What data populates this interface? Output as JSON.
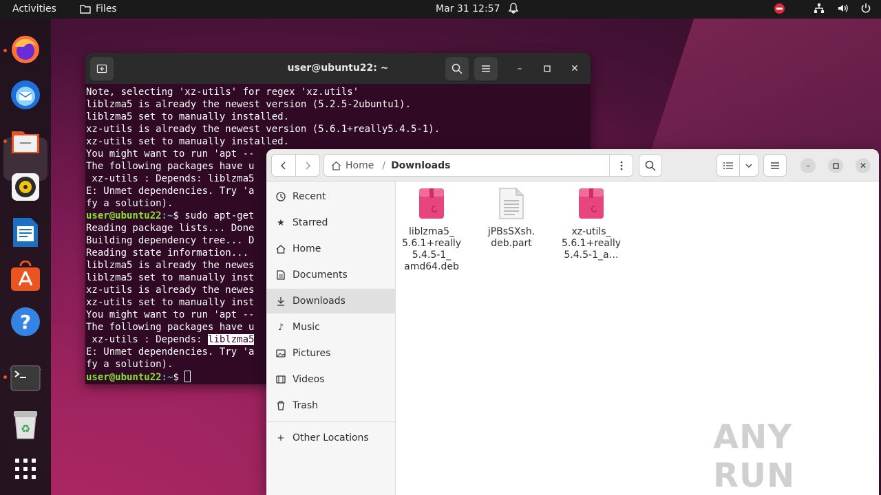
{
  "topbar": {
    "activities": "Activities",
    "app_name": "Files",
    "clock": "Mar 31  12:57"
  },
  "dock": {
    "apps": [
      "Firefox",
      "Thunderbird",
      "Files",
      "Rhythmbox",
      "LibreOffice Writer",
      "Ubuntu Software",
      "Help",
      "Terminal",
      "Trash",
      "Show Applications"
    ]
  },
  "terminal": {
    "title": "user@ubuntu22: ~",
    "lines": [
      "Note, selecting 'xz-utils' for regex 'xz.utils'",
      "liblzma5 is already the newest version (5.2.5-2ubuntu1).",
      "liblzma5 set to manually installed.",
      "xz-utils is already the newest version (5.6.1+really5.4.5-1).",
      "xz-utils set to manually installed.",
      "You might want to run 'apt --",
      "The following packages have u",
      " xz-utils : Depends: liblzma5",
      "E: Unmet dependencies. Try 'a",
      "fy a solution)."
    ],
    "prompt_user": "user@ubuntu22",
    "prompt_path": ":~",
    "prompt_symbol": "$",
    "command1": " sudo apt-get",
    "lines2": [
      "Reading package lists... Done",
      "Building dependency tree... D",
      "Reading state information...",
      "liblzma5 is already the newes",
      "liblzma5 set to manually inst",
      "xz-utils is already the newes",
      "xz-utils set to manually inst",
      "You might want to run 'apt --",
      "The following packages have u"
    ],
    "depends_prefix": " xz-utils : Depends: ",
    "depends_highlight": "liblzma5",
    "lines3": [
      "E: Unmet dependencies. Try 'a",
      "fy a solution)."
    ]
  },
  "files": {
    "path_home": "Home",
    "path_current": "Downloads",
    "sidebar": [
      {
        "label": "Recent",
        "icon": "clock-icon"
      },
      {
        "label": "Starred",
        "icon": "star-icon"
      },
      {
        "label": "Home",
        "icon": "home-icon"
      },
      {
        "label": "Documents",
        "icon": "document-icon"
      },
      {
        "label": "Downloads",
        "icon": "download-icon"
      },
      {
        "label": "Music",
        "icon": "music-icon"
      },
      {
        "label": "Pictures",
        "icon": "picture-icon"
      },
      {
        "label": "Videos",
        "icon": "video-icon"
      },
      {
        "label": "Trash",
        "icon": "trash-icon"
      }
    ],
    "other_locations": "Other Locations",
    "items": [
      {
        "name": "liblzma5_\n5.6.1+really\n5.4.5-1_\namd64.deb",
        "icon": "deb-package-icon"
      },
      {
        "name": "jPBsSXsh.\ndeb.part",
        "icon": "text-file-icon"
      },
      {
        "name": "xz-utils_\n5.6.1+really\n5.4.5-1_a…",
        "icon": "deb-package-icon"
      }
    ]
  },
  "watermark": "ANY RUN"
}
